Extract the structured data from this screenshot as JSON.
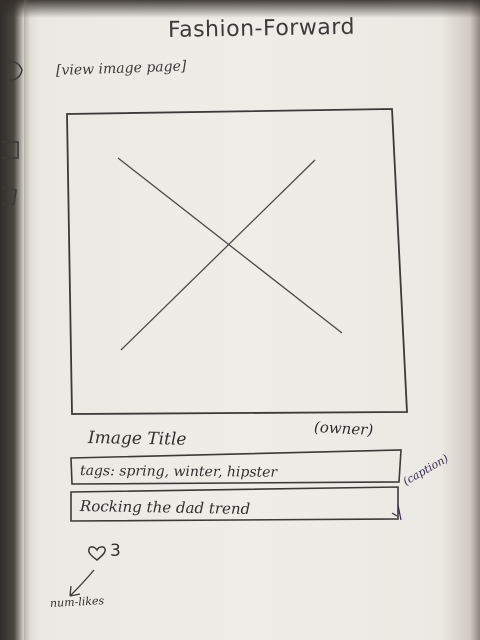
{
  "app": {
    "title": "Fashion-Forward",
    "page_label": "[view image page]"
  },
  "image_view": {
    "image_icon": "image-placeholder-icon",
    "title": "Image Title",
    "owner": "(owner)"
  },
  "tags": {
    "text": "tags: spring, winter, hipster"
  },
  "caption": {
    "text": "Rocking the dad trend",
    "label": "(caption)"
  },
  "likes": {
    "icon": "heart-icon",
    "count": "3",
    "annotation": "num-likes"
  },
  "colors": {
    "ink": "#2f2f2f",
    "purple_ink": "#3a2a5a",
    "paper": "#efede8"
  }
}
